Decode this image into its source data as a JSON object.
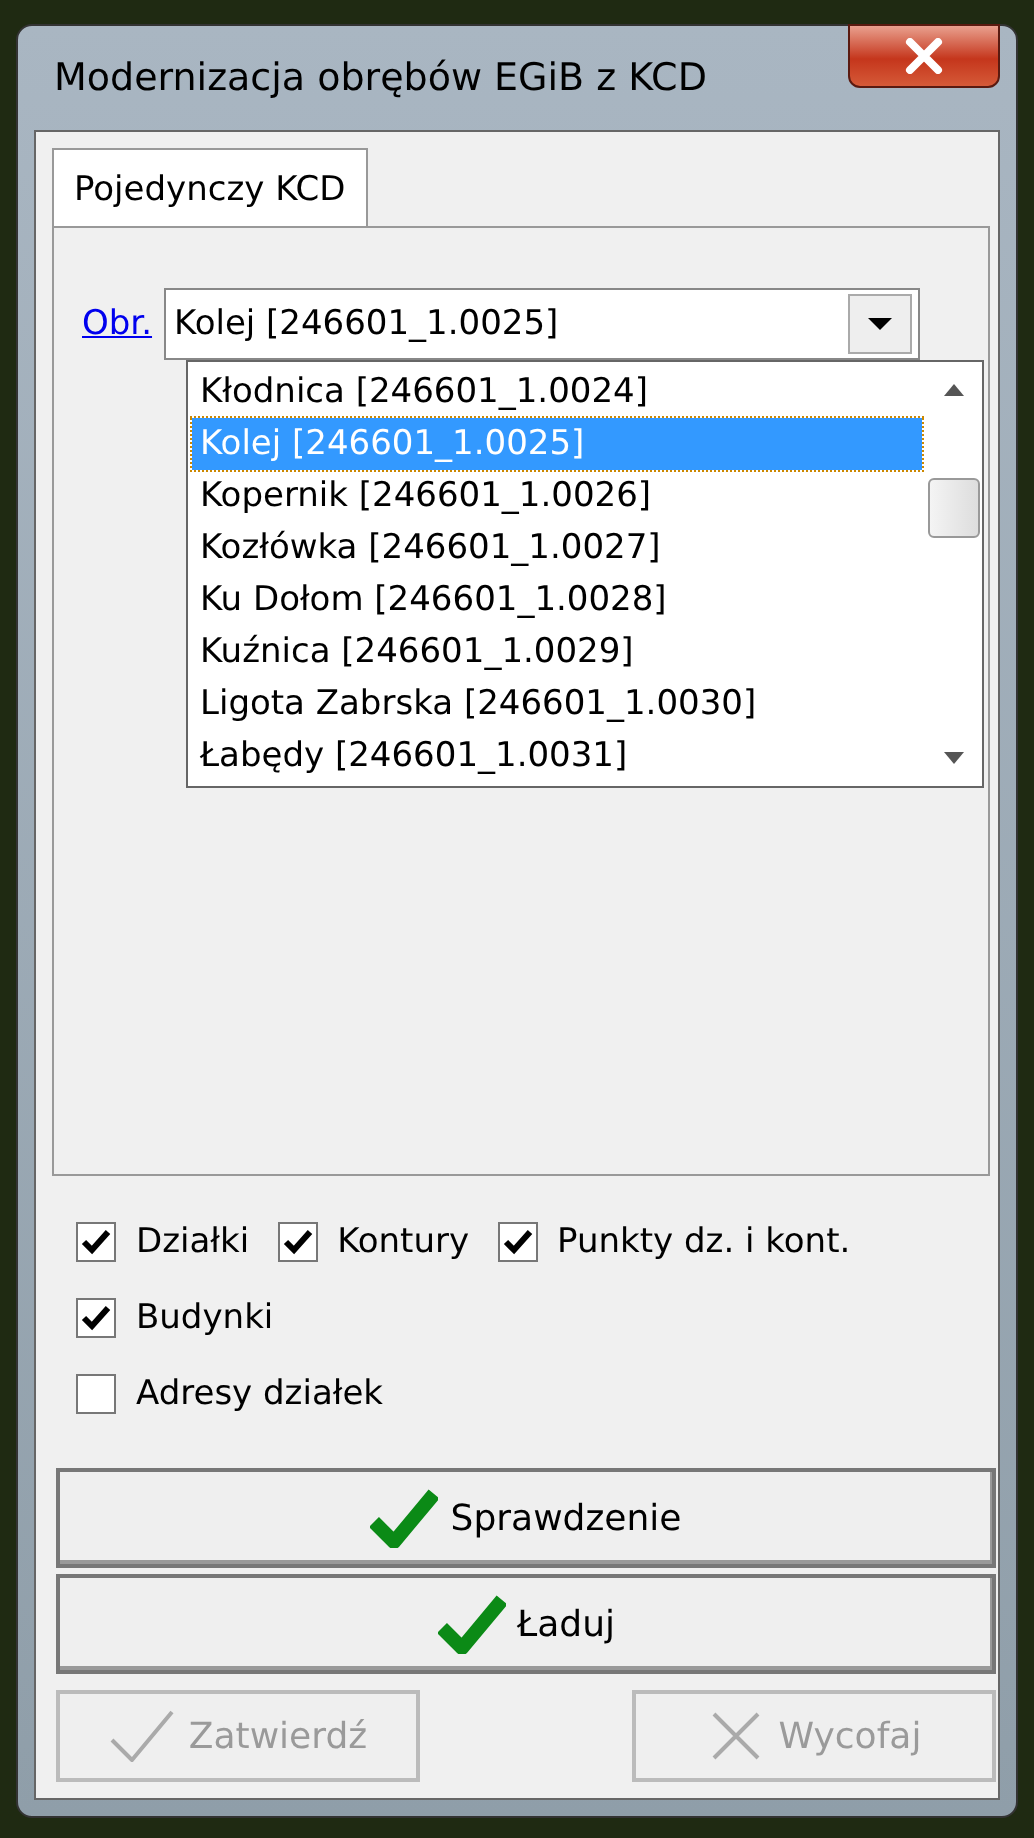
{
  "window": {
    "title": "Modernizacja obrębów EGiB z KCD"
  },
  "tabs": [
    {
      "label": "Pojedynczy KCD",
      "selected": true
    }
  ],
  "obreb": {
    "label": "Obr.",
    "value": "Kolej [246601_1.0025]",
    "options": [
      {
        "label": "Kłodnica [246601_1.0024]",
        "selected": false
      },
      {
        "label": "Kolej [246601_1.0025]",
        "selected": true
      },
      {
        "label": "Kopernik [246601_1.0026]",
        "selected": false
      },
      {
        "label": "Kozłówka [246601_1.0027]",
        "selected": false
      },
      {
        "label": "Ku Dołom [246601_1.0028]",
        "selected": false
      },
      {
        "label": "Kuźnica [246601_1.0029]",
        "selected": false
      },
      {
        "label": "Ligota Zabrska [246601_1.0030]",
        "selected": false
      },
      {
        "label": "Łabędy [246601_1.0031]",
        "selected": false
      }
    ]
  },
  "checkbox_rows": [
    [
      {
        "label": "Działki",
        "checked": true
      },
      {
        "label": "Kontury",
        "checked": true
      },
      {
        "label": "Punkty dz. i kont.",
        "checked": true
      }
    ],
    [
      {
        "label": "Budynki",
        "checked": true
      }
    ],
    [
      {
        "label": "Adresy działek",
        "checked": false
      }
    ]
  ],
  "main_buttons": [
    {
      "label": "Sprawdzenie",
      "kind": "confirm",
      "disabled": false
    },
    {
      "label": "Ładuj",
      "kind": "confirm",
      "disabled": false
    }
  ],
  "footer_buttons": [
    {
      "label": "Zatwierdź",
      "kind": "confirm",
      "disabled": true
    },
    {
      "label": "Wycofaj",
      "kind": "cancel",
      "disabled": true
    }
  ]
}
